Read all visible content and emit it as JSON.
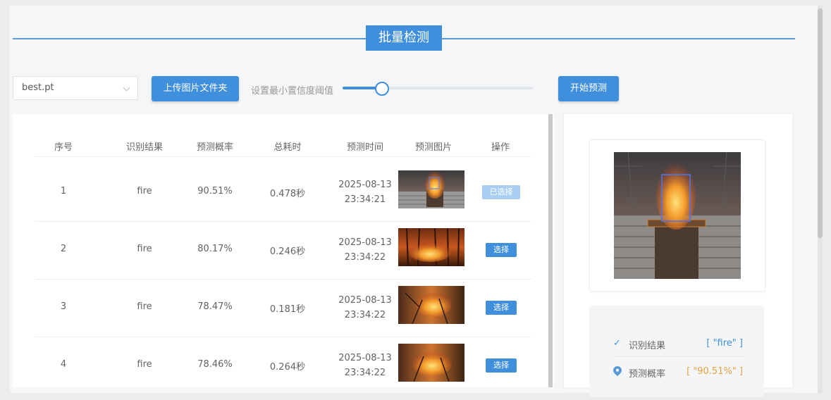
{
  "section_title": "批量检测",
  "toolbar": {
    "model_value": "best.pt",
    "upload_label": "上传图片文件夹",
    "threshold_label": "设置最小置信度阈值",
    "threshold_value": 0.2,
    "start_label": "开始预测"
  },
  "table": {
    "columns": [
      "序号",
      "识别结果",
      "预测概率",
      "总耗时",
      "预测时间",
      "预测图片",
      "操作"
    ],
    "rows": [
      {
        "index": "1",
        "result": "fire",
        "prob": "90.51%",
        "time_cost": "0.478秒",
        "date": "2025-08-13",
        "clock": "23:34:21",
        "action": "已选择",
        "selected": true
      },
      {
        "index": "2",
        "result": "fire",
        "prob": "80.17%",
        "time_cost": "0.246秒",
        "date": "2025-08-13",
        "clock": "23:34:22",
        "action": "选择",
        "selected": false
      },
      {
        "index": "3",
        "result": "fire",
        "prob": "78.47%",
        "time_cost": "0.181秒",
        "date": "2025-08-13",
        "clock": "23:34:22",
        "action": "选择",
        "selected": false
      },
      {
        "index": "4",
        "result": "fire",
        "prob": "78.46%",
        "time_cost": "0.264秒",
        "date": "2025-08-13",
        "clock": "23:34:22",
        "action": "选择",
        "selected": false
      }
    ]
  },
  "detail": {
    "result_label": "识别结果",
    "result_value": "[ \"fire\" ]",
    "prob_label": "预测概率",
    "prob_value": "[ \"90.51%\" ]",
    "result_icon": "check-icon",
    "prob_icon": "location-pin-icon"
  },
  "colors": {
    "accent": "#3f8fdc",
    "selected_button": "#a8cff2",
    "result_value": "#3f8fdc",
    "prob_value": "#e6a23c"
  }
}
